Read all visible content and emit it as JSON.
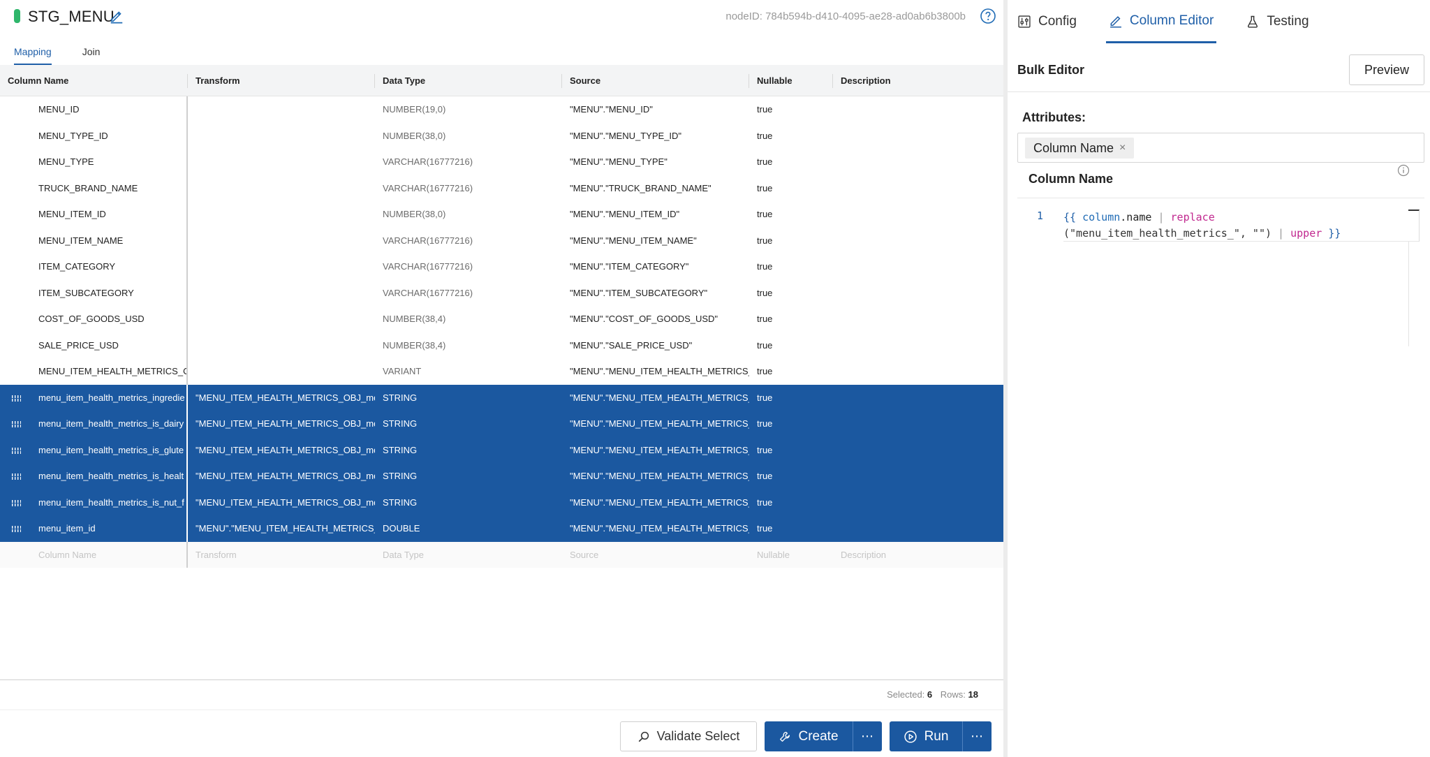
{
  "node": {
    "title": "STG_MENU",
    "node_id": "nodeID: 784b594b-d410-4095-ae28-ad0ab6b3800b",
    "accent_color": "#2fb66b"
  },
  "mode_tabs": [
    {
      "label": "Mapping",
      "active": true
    },
    {
      "label": "Join",
      "active": false
    }
  ],
  "columns": {
    "headers": [
      "Column Name",
      "Transform",
      "Data Type",
      "Source",
      "Nullable",
      "Description"
    ],
    "rows": [
      {
        "name": "MENU_ID",
        "transform": "",
        "type": "NUMBER(19,0)",
        "source": "\"MENU\".\"MENU_ID\"",
        "nullable": "true",
        "description": "",
        "selected": false
      },
      {
        "name": "MENU_TYPE_ID",
        "transform": "",
        "type": "NUMBER(38,0)",
        "source": "\"MENU\".\"MENU_TYPE_ID\"",
        "nullable": "true",
        "description": "",
        "selected": false
      },
      {
        "name": "MENU_TYPE",
        "transform": "",
        "type": "VARCHAR(16777216)",
        "source": "\"MENU\".\"MENU_TYPE\"",
        "nullable": "true",
        "description": "",
        "selected": false
      },
      {
        "name": "TRUCK_BRAND_NAME",
        "transform": "",
        "type": "VARCHAR(16777216)",
        "source": "\"MENU\".\"TRUCK_BRAND_NAME\"",
        "nullable": "true",
        "description": "",
        "selected": false
      },
      {
        "name": "MENU_ITEM_ID",
        "transform": "",
        "type": "NUMBER(38,0)",
        "source": "\"MENU\".\"MENU_ITEM_ID\"",
        "nullable": "true",
        "description": "",
        "selected": false
      },
      {
        "name": "MENU_ITEM_NAME",
        "transform": "",
        "type": "VARCHAR(16777216)",
        "source": "\"MENU\".\"MENU_ITEM_NAME\"",
        "nullable": "true",
        "description": "",
        "selected": false
      },
      {
        "name": "ITEM_CATEGORY",
        "transform": "",
        "type": "VARCHAR(16777216)",
        "source": "\"MENU\".\"ITEM_CATEGORY\"",
        "nullable": "true",
        "description": "",
        "selected": false
      },
      {
        "name": "ITEM_SUBCATEGORY",
        "transform": "",
        "type": "VARCHAR(16777216)",
        "source": "\"MENU\".\"ITEM_SUBCATEGORY\"",
        "nullable": "true",
        "description": "",
        "selected": false
      },
      {
        "name": "COST_OF_GOODS_USD",
        "transform": "",
        "type": "NUMBER(38,4)",
        "source": "\"MENU\".\"COST_OF_GOODS_USD\"",
        "nullable": "true",
        "description": "",
        "selected": false
      },
      {
        "name": "SALE_PRICE_USD",
        "transform": "",
        "type": "NUMBER(38,4)",
        "source": "\"MENU\".\"SALE_PRICE_USD\"",
        "nullable": "true",
        "description": "",
        "selected": false
      },
      {
        "name": "MENU_ITEM_HEALTH_METRICS_OE",
        "transform": "",
        "type": "VARIANT",
        "source": "\"MENU\".\"MENU_ITEM_HEALTH_METRICS_C",
        "nullable": "true",
        "description": "",
        "selected": false
      },
      {
        "name": "menu_item_health_metrics_ingredie",
        "transform": "\"MENU_ITEM_HEALTH_METRICS_OBJ_mer",
        "type": "STRING",
        "source": "\"MENU\".\"MENU_ITEM_HEALTH_METRICS_C",
        "nullable": "true",
        "description": "",
        "selected": true
      },
      {
        "name": "menu_item_health_metrics_is_dairy",
        "transform": "\"MENU_ITEM_HEALTH_METRICS_OBJ_mer",
        "type": "STRING",
        "source": "\"MENU\".\"MENU_ITEM_HEALTH_METRICS_C",
        "nullable": "true",
        "description": "",
        "selected": true
      },
      {
        "name": "menu_item_health_metrics_is_glute",
        "transform": "\"MENU_ITEM_HEALTH_METRICS_OBJ_mer",
        "type": "STRING",
        "source": "\"MENU\".\"MENU_ITEM_HEALTH_METRICS_C",
        "nullable": "true",
        "description": "",
        "selected": true
      },
      {
        "name": "menu_item_health_metrics_is_healt",
        "transform": "\"MENU_ITEM_HEALTH_METRICS_OBJ_mer",
        "type": "STRING",
        "source": "\"MENU\".\"MENU_ITEM_HEALTH_METRICS_C",
        "nullable": "true",
        "description": "",
        "selected": true
      },
      {
        "name": "menu_item_health_metrics_is_nut_f",
        "transform": "\"MENU_ITEM_HEALTH_METRICS_OBJ_mer",
        "type": "STRING",
        "source": "\"MENU\".\"MENU_ITEM_HEALTH_METRICS_C",
        "nullable": "true",
        "description": "",
        "selected": true
      },
      {
        "name": "menu_item_id",
        "transform": "\"MENU\".\"MENU_ITEM_HEALTH_METRICS_C",
        "type": "DOUBLE",
        "source": "\"MENU\".\"MENU_ITEM_HEALTH_METRICS_C",
        "nullable": "true",
        "description": "",
        "selected": true
      }
    ],
    "new_row_placeholders": {
      "name": "Column Name",
      "transform": "Transform",
      "type": "Data Type",
      "source": "Source",
      "nullable": "Nullable",
      "description": "Description"
    },
    "selection_color": "#1b58a0"
  },
  "stats": {
    "selected_label": "Selected:",
    "selected_value": "6",
    "rows_label": "Rows:",
    "rows_value": "18"
  },
  "actions": {
    "validate_label": "Validate Select",
    "create_label": "Create",
    "run_label": "Run",
    "more_label": "⋯"
  },
  "panel_tabs": [
    {
      "label": "Config",
      "icon": "sliders-icon",
      "active": false
    },
    {
      "label": "Column Editor",
      "icon": "pencil-icon",
      "active": true
    },
    {
      "label": "Testing",
      "icon": "flask-icon",
      "active": false
    }
  ],
  "bulk_editor": {
    "title": "Bulk Editor",
    "preview_label": "Preview",
    "attributes_label": "Attributes:",
    "attribute_chip": "Column Name",
    "chip_remove": "×",
    "section_title": "Column Name",
    "line_number": "1",
    "code_tokens": {
      "open": "{{ ",
      "var": "column",
      "prop": ".name ",
      "pipe1": "| ",
      "fn1": "replace",
      "args": "(\"menu_item_health_metrics_\", \"\") ",
      "pipe2": "| ",
      "fn2": "upper",
      "close": " }}"
    }
  }
}
